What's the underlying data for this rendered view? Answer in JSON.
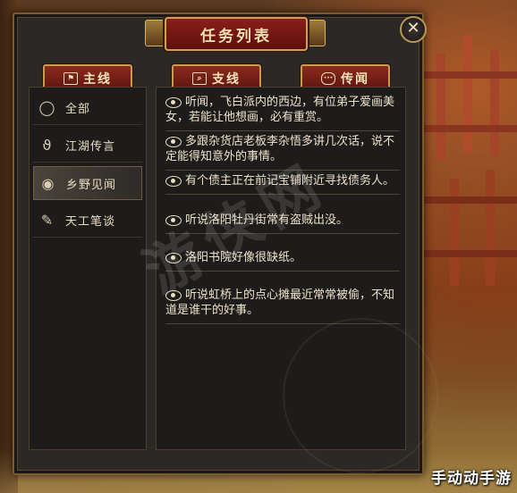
{
  "window": {
    "title": "任务列表",
    "close_label": "✕"
  },
  "tabs": [
    {
      "label": "主线",
      "icon": "flag-icon"
    },
    {
      "label": "支线",
      "icon": "search-icon"
    },
    {
      "label": "传闻",
      "icon": "speech-icon"
    }
  ],
  "categories": [
    {
      "label": "全部",
      "icon": "chat-bubble-icon",
      "active": false
    },
    {
      "label": "江湖传言",
      "icon": "ear-icon",
      "active": false
    },
    {
      "label": "乡野见闻",
      "icon": "eye-icon",
      "active": true
    },
    {
      "label": "天工笔谈",
      "icon": "brush-icon",
      "active": false
    }
  ],
  "rumors": [
    {
      "text": "听闻，飞白派内的西边，有位弟子爱画美女，若能让他想画，必有重赏。"
    },
    {
      "text": "多跟杂货店老板李杂悟多讲几次话，说不定能得知意外的事情。"
    },
    {
      "text": "有个债主正在前记宝铺附近寻找债务人。"
    },
    {
      "text": "听说洛阳牡丹街常有盗贼出没。"
    },
    {
      "text": "洛阳书院好像很缺纸。"
    },
    {
      "text": "听说虹桥上的点心摊最近常常被偷，不知道是谁干的好事。"
    }
  ],
  "watermark": "游侠网",
  "corner_logo": "手动动手游",
  "colors": {
    "accent_red": "#8c2a1e",
    "gold_border": "#c69c54",
    "panel_bg": "#2c2825"
  }
}
